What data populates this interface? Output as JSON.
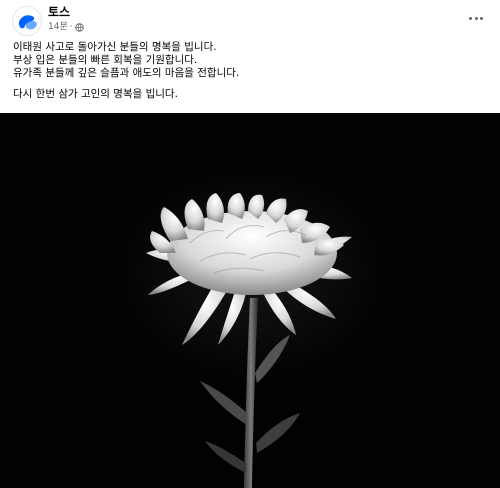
{
  "post": {
    "author": {
      "name": "토스",
      "avatar_icon": "toss-logo-icon",
      "brand_color": "#0064ff"
    },
    "timestamp": "14분",
    "separator": "·",
    "privacy_icon": "globe-icon",
    "more_icon": "more-options-icon",
    "text_lines": [
      "이태원 사고로 돌아가신 분들의 명복을 빕니다.",
      "부상 입은 분들의 빠른 회복을 기원합니다.",
      "유가족 분들께 깊은 슬픔과 애도의 마음을 전합니다.",
      "다시 한번 삼가 고인의 명복을 빕니다."
    ],
    "image": {
      "subject": "white-chrysanthemum",
      "background_color": "#020202"
    }
  }
}
